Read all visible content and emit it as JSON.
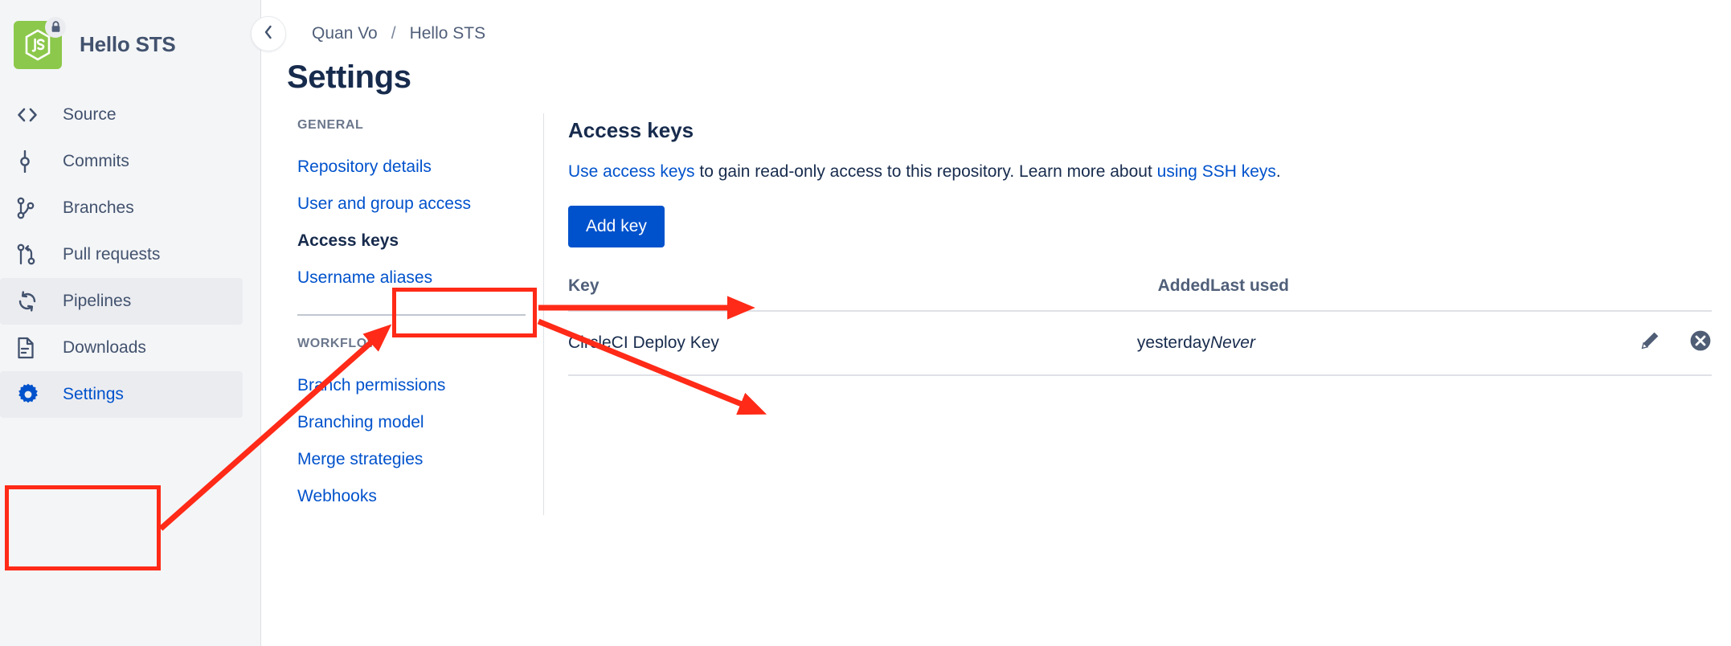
{
  "sidebar": {
    "repo_name": "Hello STS",
    "logo_icon": "nodejs-logo",
    "lock_icon": "lock-icon",
    "items": [
      {
        "label": "Source",
        "icon": "code-brackets-icon",
        "state": "normal"
      },
      {
        "label": "Commits",
        "icon": "commit-icon",
        "state": "normal"
      },
      {
        "label": "Branches",
        "icon": "branches-icon",
        "state": "normal"
      },
      {
        "label": "Pull requests",
        "icon": "pull-request-icon",
        "state": "normal"
      },
      {
        "label": "Pipelines",
        "icon": "pipelines-icon",
        "state": "hovered"
      },
      {
        "label": "Downloads",
        "icon": "downloads-icon",
        "state": "normal"
      },
      {
        "label": "Settings",
        "icon": "gear-icon",
        "state": "selected"
      }
    ]
  },
  "header": {
    "back_icon": "chevron-left-icon",
    "breadcrumb": {
      "workspace": "Quan Vo",
      "separator": "/",
      "repository": "Hello STS"
    },
    "page_title": "Settings"
  },
  "settings_nav": {
    "groups": [
      {
        "title": "GENERAL",
        "items": [
          {
            "label": "Repository details",
            "active": false
          },
          {
            "label": "User and group access",
            "active": false
          },
          {
            "label": "Access keys",
            "active": true
          },
          {
            "label": "Username aliases",
            "active": false
          }
        ]
      },
      {
        "title": "WORKFLOW",
        "items": [
          {
            "label": "Branch permissions",
            "active": false
          },
          {
            "label": "Branching model",
            "active": false
          },
          {
            "label": "Merge strategies",
            "active": false
          },
          {
            "label": "Webhooks",
            "active": false
          }
        ]
      }
    ]
  },
  "panel": {
    "title": "Access keys",
    "description": {
      "link1": "Use access keys",
      "mid": " to gain read-only access to this repository. Learn more about ",
      "link2": "using SSH keys",
      "end": "."
    },
    "add_key_label": "Add key",
    "table": {
      "columns": [
        "Key",
        "Added",
        "Last used"
      ],
      "rows": [
        {
          "key": "CircleCI Deploy Key",
          "added": "yesterday",
          "last_used": "Never",
          "edit_icon": "pencil-icon",
          "delete_icon": "close-circle-icon"
        }
      ]
    }
  },
  "annotations": {
    "color": "#ff2a17",
    "boxes": [
      "settings-sidebar-item",
      "access-keys-nav-item"
    ],
    "arrows": [
      "settings-box-to-access-keys-box",
      "access-keys-box-to-add-key-button",
      "access-keys-box-to-key-row"
    ]
  },
  "colors": {
    "accent_blue": "#0052cc",
    "text_dark": "#172b4d",
    "text_muted": "#505f79",
    "sidebar_bg": "#f4f5f7",
    "logo_green": "#8cc84b",
    "annotation_red": "#ff2a17"
  }
}
